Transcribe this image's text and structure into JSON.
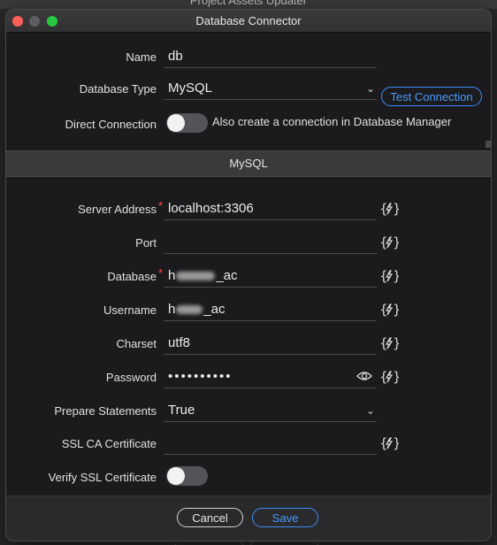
{
  "background_window": {
    "title": "Project Assets Updater"
  },
  "dialog": {
    "title": "Database Connector"
  },
  "general": {
    "name_label": "Name",
    "name_value": "db",
    "db_type_label": "Database Type",
    "db_type_value": "MySQL",
    "test_connection_label": "Test Connection",
    "direct_connection_label": "Direct Connection",
    "direct_connection_note": "Also create a connection in Database Manager",
    "direct_connection_on": false
  },
  "section": {
    "title": "MySQL"
  },
  "mysql": {
    "server_label": "Server Address",
    "server_value": "localhost:3306",
    "port_label": "Port",
    "port_value": "",
    "database_label": "Database",
    "database_prefix": "h",
    "database_suffix": "_ac",
    "username_label": "Username",
    "username_prefix": "h",
    "username_suffix": "_ac",
    "charset_label": "Charset",
    "charset_value": "utf8",
    "password_label": "Password",
    "password_value": "••••••••••",
    "prepare_label": "Prepare Statements",
    "prepare_value": "True",
    "ssl_ca_label": "SSL CA Certificate",
    "ssl_ca_value": "",
    "verify_ssl_label": "Verify SSL Certificate",
    "verify_ssl_on": false
  },
  "footer": {
    "cancel_label": "Cancel",
    "save_label": "Save"
  },
  "colors": {
    "accent": "#3b8cf5",
    "required": "#ff4d4d",
    "toggle_off": "#545458"
  }
}
